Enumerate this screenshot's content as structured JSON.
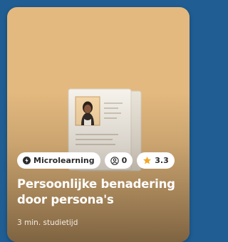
{
  "card": {
    "badges": {
      "type_label": "Microlearning",
      "type_icon": "bolt-icon",
      "participants_count": "0",
      "participants_icon": "user-icon",
      "rating": "3.3",
      "rating_icon": "star-icon"
    },
    "title": "Persoonlijke benadering door persona's",
    "duration": "3 min. studietijd"
  },
  "colors": {
    "page_background": "#1f5d93",
    "card_background": "#e3b97f",
    "star": "#f5a623",
    "badge_background": "#ffffff"
  }
}
